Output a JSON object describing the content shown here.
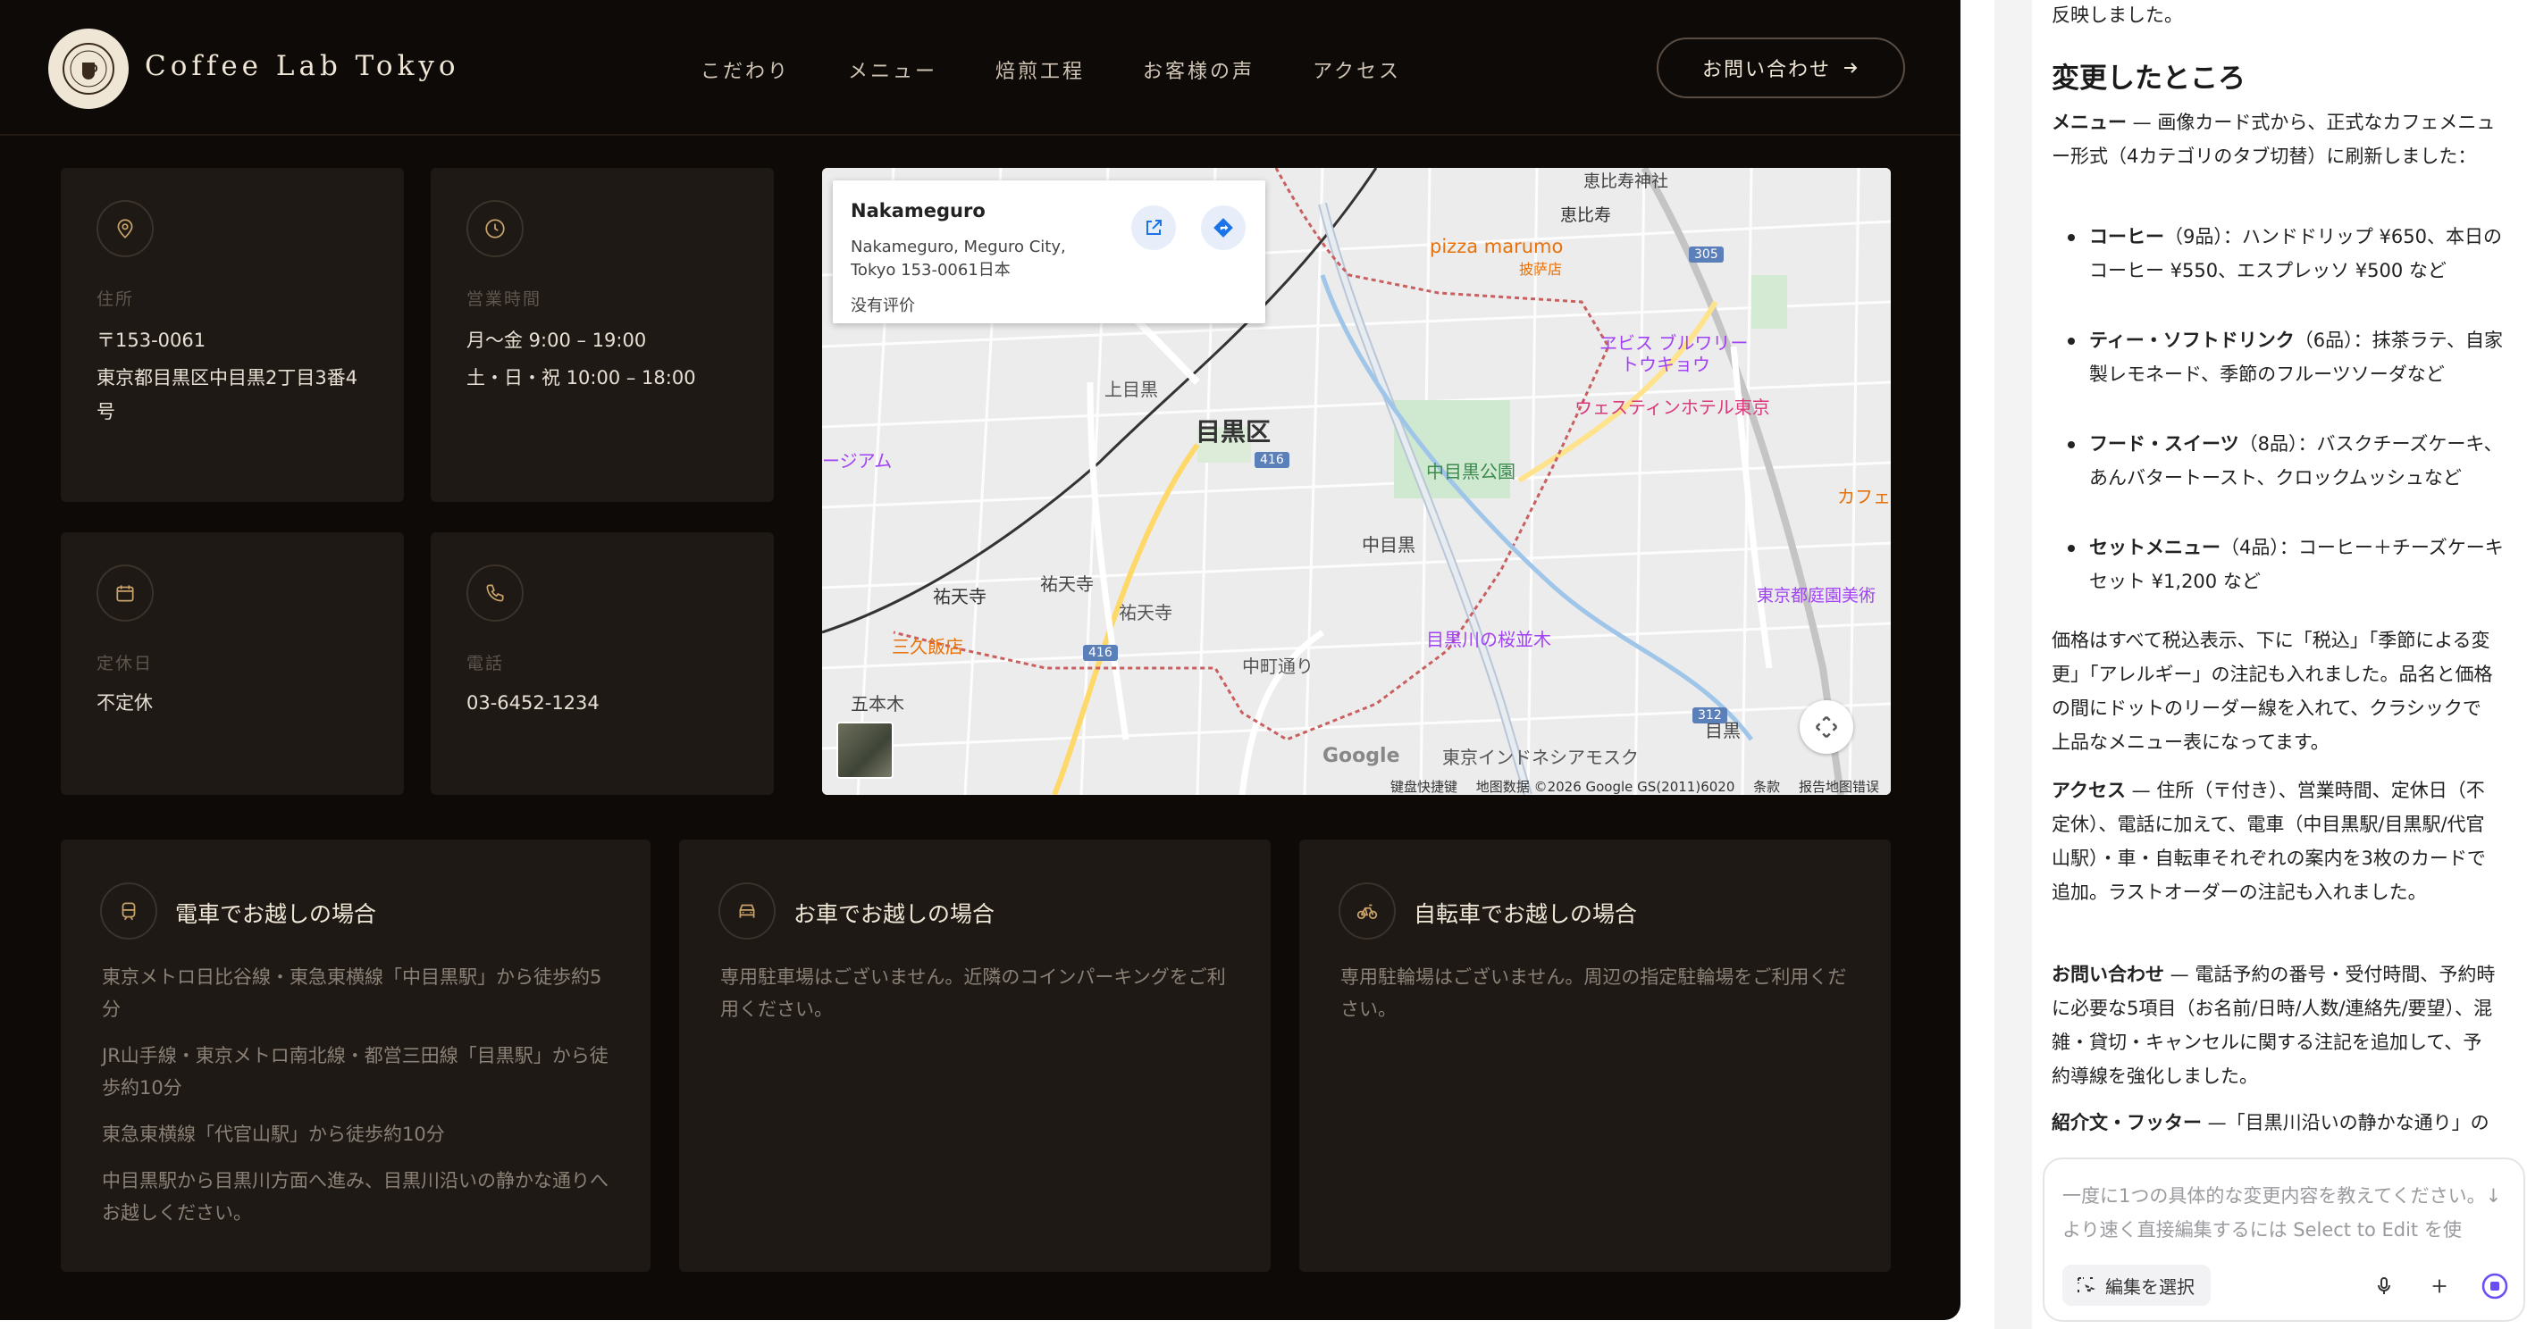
{
  "site": {
    "brand": "Coffee Lab Tokyo",
    "nav": [
      "こだわり",
      "メニュー",
      "焙煎工程",
      "お客様の声",
      "アクセス"
    ],
    "contact_button": "お問い合わせ",
    "info_cards": [
      {
        "icon": "map-pin-icon",
        "label": "住所",
        "lines": [
          "〒153-0061",
          "東京都目黒区中目黒2丁目3番4",
          "号"
        ]
      },
      {
        "icon": "clock-icon",
        "label": "営業時間",
        "lines": [
          "月〜金 9:00 – 19:00",
          "土・日・祝 10:00 – 18:00"
        ]
      },
      {
        "icon": "calendar-icon",
        "label": "定休日",
        "lines": [
          "不定休"
        ]
      },
      {
        "icon": "phone-icon",
        "label": "電話",
        "lines": [
          "03-6452-1234"
        ]
      }
    ],
    "map": {
      "popup_title": "Nakameguro",
      "popup_address_1": "Nakameguro, Meguro City,",
      "popup_address_2": "Tokyo 153-0061日本",
      "popup_rating": "没有评价",
      "labels": {
        "ebisu_shrine": "恵比寿神社",
        "ebisu": "恵比寿",
        "pizza": "pizza marumo",
        "pizza_sub": "披萨店",
        "kamimeguro": "上目黒",
        "meguro_ku": "目黒区",
        "museum_left": "ージアム",
        "ebisu_garden": "ヱビス ブルワリー",
        "ebisu_garden_2": "トウキョウ",
        "westin": "ウェスティンホテル東京",
        "park": "中目黒公園",
        "nakameguro": "中目黒",
        "yutenji": "祐天寺",
        "yutenji_2": "祐天寺",
        "yutenji_temple": "祐天寺",
        "sankyu": "三久飯店",
        "sakura": "目黒川の桜並木",
        "teien": "東京都庭園美術",
        "cafe": "カフェ",
        "gohongi": "五本木",
        "mosque": "東京インドネシアモスク",
        "meguro_station": "目黒",
        "nakacho": "中町通り",
        "google": "Google"
      },
      "route_numbers": [
        "305",
        "416",
        "416",
        "312"
      ],
      "attribution": [
        "键盘快捷键",
        "地图数据 ©2026 Google GS(2011)6020",
        "条款",
        "报告地图错误"
      ]
    },
    "access_cards": [
      {
        "icon": "train-icon",
        "title": "電車でお越しの場合",
        "lines": [
          "東京メトロ日比谷線・東急東横線「中目黒駅」から徒歩約5分",
          "JR山手線・東京メトロ南北線・都営三田線「目黒駅」から徒歩約10分",
          "東急東横線「代官山駅」から徒歩約10分",
          "中目黒駅から目黒川方面へ進み、目黒川沿いの静かな通りへお越しください。"
        ]
      },
      {
        "icon": "car-icon",
        "title": "お車でお越しの場合",
        "lines": [
          "専用駐車場はございません。近隣のコインパーキングをご利用ください。"
        ]
      },
      {
        "icon": "bicycle-icon",
        "title": "自転車でお越しの場合",
        "lines": [
          "専用駐輪場はございません。周辺の指定駐輪場をご利用ください。"
        ]
      }
    ]
  },
  "panel": {
    "top_line": "反映しました。",
    "heading": "変更したところ",
    "menu_intro_bold": "メニュー",
    "menu_intro": " — 画像カード式から、正式なカフェメニュー形式（4カテゴリのタブ切替）に刷新しました：",
    "bullets": [
      {
        "bold": "コーヒー",
        "text": "（9品）：ハンドドリップ ¥650、本日のコーヒー ¥550、エスプレッソ ¥500 など"
      },
      {
        "bold": "ティー・ソフトドリンク",
        "text": "（6品）：抹茶ラテ、自家製レモネード、季節のフルーツソーダなど"
      },
      {
        "bold": "フード・スイーツ",
        "text": "（8品）：バスクチーズケーキ、あんバタートースト、クロックムッシュなど"
      },
      {
        "bold": "セットメニュー",
        "text": "（4品）：コーヒー＋チーズケーキセット ¥1,200 など"
      }
    ],
    "price_note": "価格はすべて税込表示、下に「税込」「季節による変更」「アレルギー」の注記も入れました。品名と価格の間にドットのリーダー線を入れて、クラシックで上品なメニュー表になってます。",
    "access_bold": "アクセス",
    "access_text": " — 住所（〒付き）、営業時間、定休日（不定休）、電話に加えて、電車（中目黒駅/目黒駅/代官山駅）・車・自転車それぞれの案内を3枚のカードで追加。ラストオーダーの注記も入れました。",
    "contact_bold": "お問い合わせ",
    "contact_text": " — 電話予約の番号・受付時間、予約時に必要な5項目（お名前/日時/人数/連絡先/要望）、混雑・貸切・キャンセルに関する注記を追加して、予約導線を強化しました。",
    "intro_bold": "紹介文・フッター",
    "intro_text": " —「目黒川沿いの静かな通り」の",
    "input_placeholder": "一度に1つの具体的な変更内容を教えてください。↓ より速く直接編集するには Select to Edit を使",
    "select_button": "編集を選択"
  }
}
